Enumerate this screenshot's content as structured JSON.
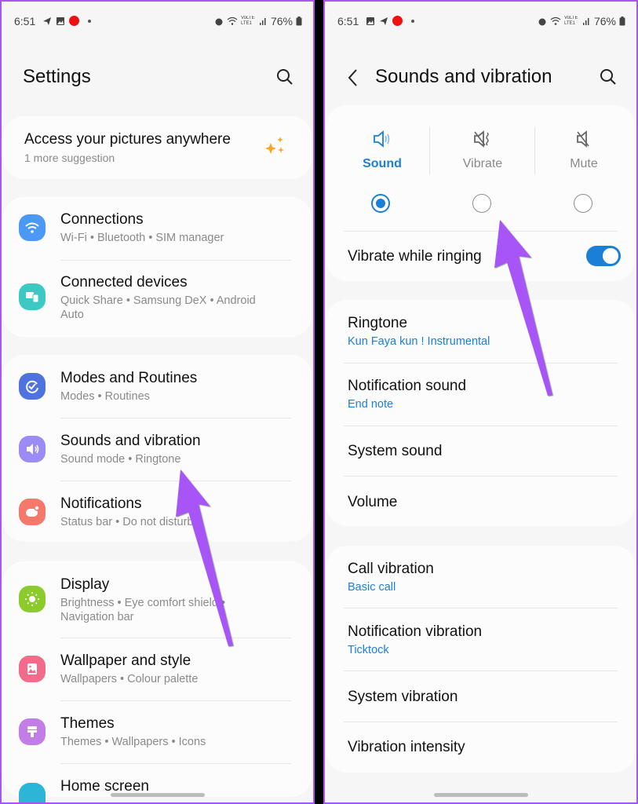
{
  "left_screen": {
    "status_bar": {
      "time": "6:51",
      "battery": "76%",
      "network": "VoLTE LTE1"
    },
    "header": {
      "title": "Settings",
      "search_icon": "search-icon"
    },
    "suggestion": {
      "title": "Access your pictures anywhere",
      "subtitle": "1 more suggestion",
      "icon": "sparkle-icon",
      "icon_color": "#f5a623"
    },
    "groups": [
      {
        "items": [
          {
            "title": "Connections",
            "subtitle": "Wi-Fi  •  Bluetooth  •  SIM manager",
            "icon": "wifi-icon",
            "color": "#4a9af5"
          },
          {
            "title": "Connected devices",
            "subtitle": "Quick Share  •  Samsung DeX  •  Android Auto",
            "icon": "devices-icon",
            "color": "#3cc9c4"
          }
        ]
      },
      {
        "items": [
          {
            "title": "Modes and Routines",
            "subtitle": "Modes  •  Routines",
            "icon": "routines-icon",
            "color": "#4e73df"
          },
          {
            "title": "Sounds and vibration",
            "subtitle": "Sound mode  •  Ringtone",
            "icon": "speaker-icon",
            "color": "#9b8cf5"
          },
          {
            "title": "Notifications",
            "subtitle": "Status bar  •  Do not disturb",
            "icon": "notification-icon",
            "color": "#f5796b"
          }
        ]
      },
      {
        "items": [
          {
            "title": "Display",
            "subtitle": "Brightness  •  Eye comfort shield  •  Navigation bar",
            "icon": "sun-icon",
            "color": "#8bcb2c"
          },
          {
            "title": "Wallpaper and style",
            "subtitle": "Wallpapers  •  Colour palette",
            "icon": "wallpaper-icon",
            "color": "#f26b8a"
          },
          {
            "title": "Themes",
            "subtitle": "Themes  •  Wallpapers  •  Icons",
            "icon": "brush-icon",
            "color": "#c27ee6"
          },
          {
            "title": "Home screen",
            "subtitle": "",
            "icon": "home-icon",
            "color": "#2cb5d6"
          }
        ]
      }
    ]
  },
  "right_screen": {
    "status_bar": {
      "time": "6:51",
      "battery": "76%",
      "network": "VoLTE LTE1"
    },
    "header": {
      "title": "Sounds and vibration",
      "back_icon": "back-icon",
      "search_icon": "search-icon"
    },
    "sound_mode": {
      "options": [
        {
          "label": "Sound",
          "icon": "speaker-icon",
          "selected": true
        },
        {
          "label": "Vibrate",
          "icon": "vibrate-icon",
          "selected": false
        },
        {
          "label": "Mute",
          "icon": "mute-icon",
          "selected": false
        }
      ],
      "vibrate_while_ringing": {
        "label": "Vibrate while ringing",
        "on": true
      }
    },
    "sound_group": [
      {
        "title": "Ringtone",
        "value": "Kun Faya kun ! Instrumental"
      },
      {
        "title": "Notification sound",
        "value": "End note"
      },
      {
        "title": "System sound",
        "value": ""
      },
      {
        "title": "Volume",
        "value": ""
      }
    ],
    "vibration_group": [
      {
        "title": "Call vibration",
        "value": "Basic call"
      },
      {
        "title": "Notification vibration",
        "value": "Ticktock"
      },
      {
        "title": "System vibration",
        "value": ""
      },
      {
        "title": "Vibration intensity",
        "value": ""
      }
    ]
  },
  "colors": {
    "accent": "#1a7fd6",
    "annotation_arrow": "#a855f7",
    "frame_border": "#a855f7"
  },
  "annotations": [
    {
      "type": "arrow",
      "points_to": "Sounds and vibration"
    },
    {
      "type": "arrow",
      "points_to": "Vibrate"
    }
  ]
}
